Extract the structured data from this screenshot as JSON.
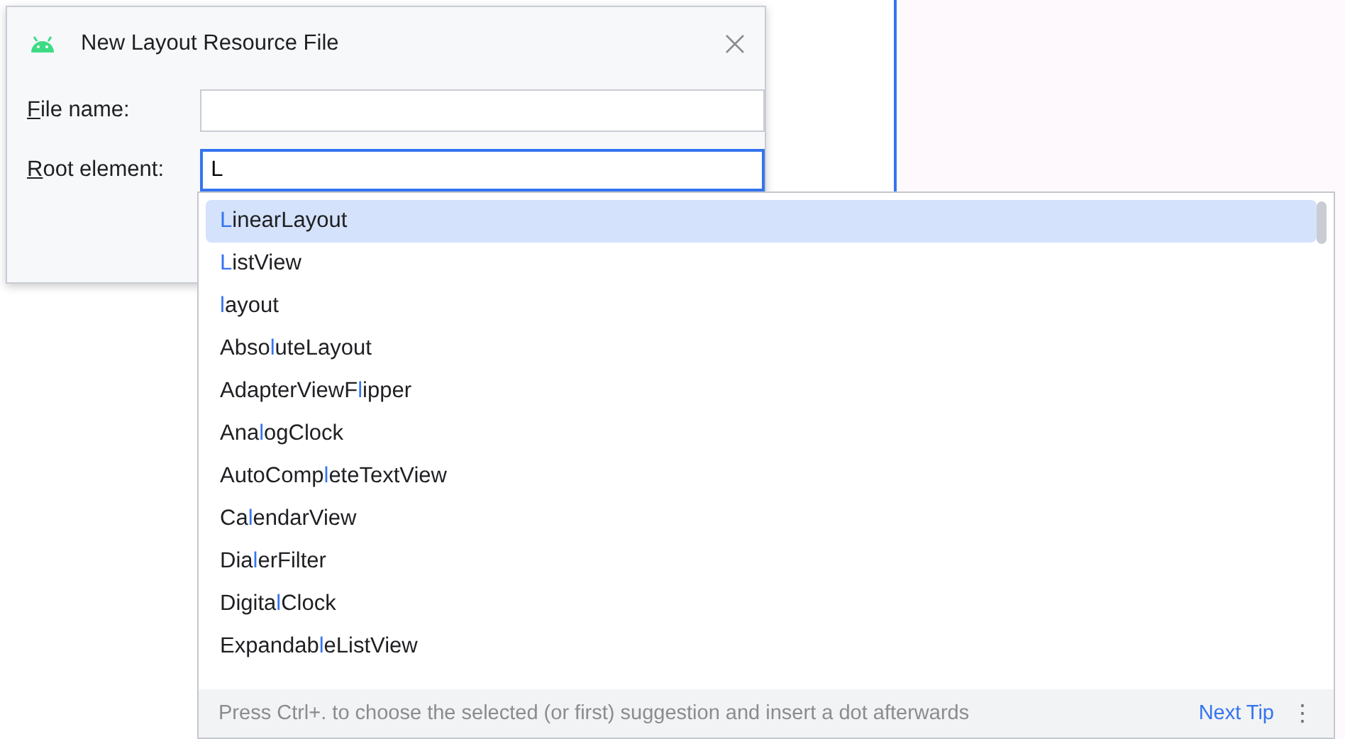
{
  "dialog": {
    "title": "New Layout Resource File",
    "fields": [
      {
        "label_key": "F",
        "label_rest": "ile name:",
        "focused": false
      },
      {
        "label_key": "R",
        "label_rest": "oot element:",
        "value": "L",
        "focused": true
      }
    ]
  },
  "completion": {
    "items": [
      {
        "match": "L",
        "suffix": "inearLayout",
        "selected": true
      },
      {
        "match": "L",
        "suffix": "istView",
        "selected": false
      },
      {
        "match": "l",
        "suffix": "ayout",
        "selected": false
      },
      {
        "prefix": "Abso",
        "match": "l",
        "suffix": "uteLayout",
        "selected": false
      },
      {
        "prefix": "AdapterViewF",
        "match": "l",
        "suffix": "ipper",
        "selected": false
      },
      {
        "prefix": "Ana",
        "match": "l",
        "suffix": "ogClock",
        "selected": false
      },
      {
        "prefix": "AutoComp",
        "match": "l",
        "suffix": "eteTextView",
        "selected": false
      },
      {
        "prefix": "Ca",
        "match": "l",
        "suffix": "endarView",
        "selected": false
      },
      {
        "prefix": "Dia",
        "match": "l",
        "suffix": "erFilter",
        "selected": false
      },
      {
        "prefix": "Digita",
        "match": "l",
        "suffix": "Clock",
        "selected": false
      },
      {
        "prefix": "Expandab",
        "match": "l",
        "suffix": "eListView",
        "selected": false
      }
    ],
    "hint": "Press Ctrl+. to choose the selected (or first) suggestion and insert a dot afterwards",
    "hint_link": "Next Tip",
    "more": "⋮"
  }
}
